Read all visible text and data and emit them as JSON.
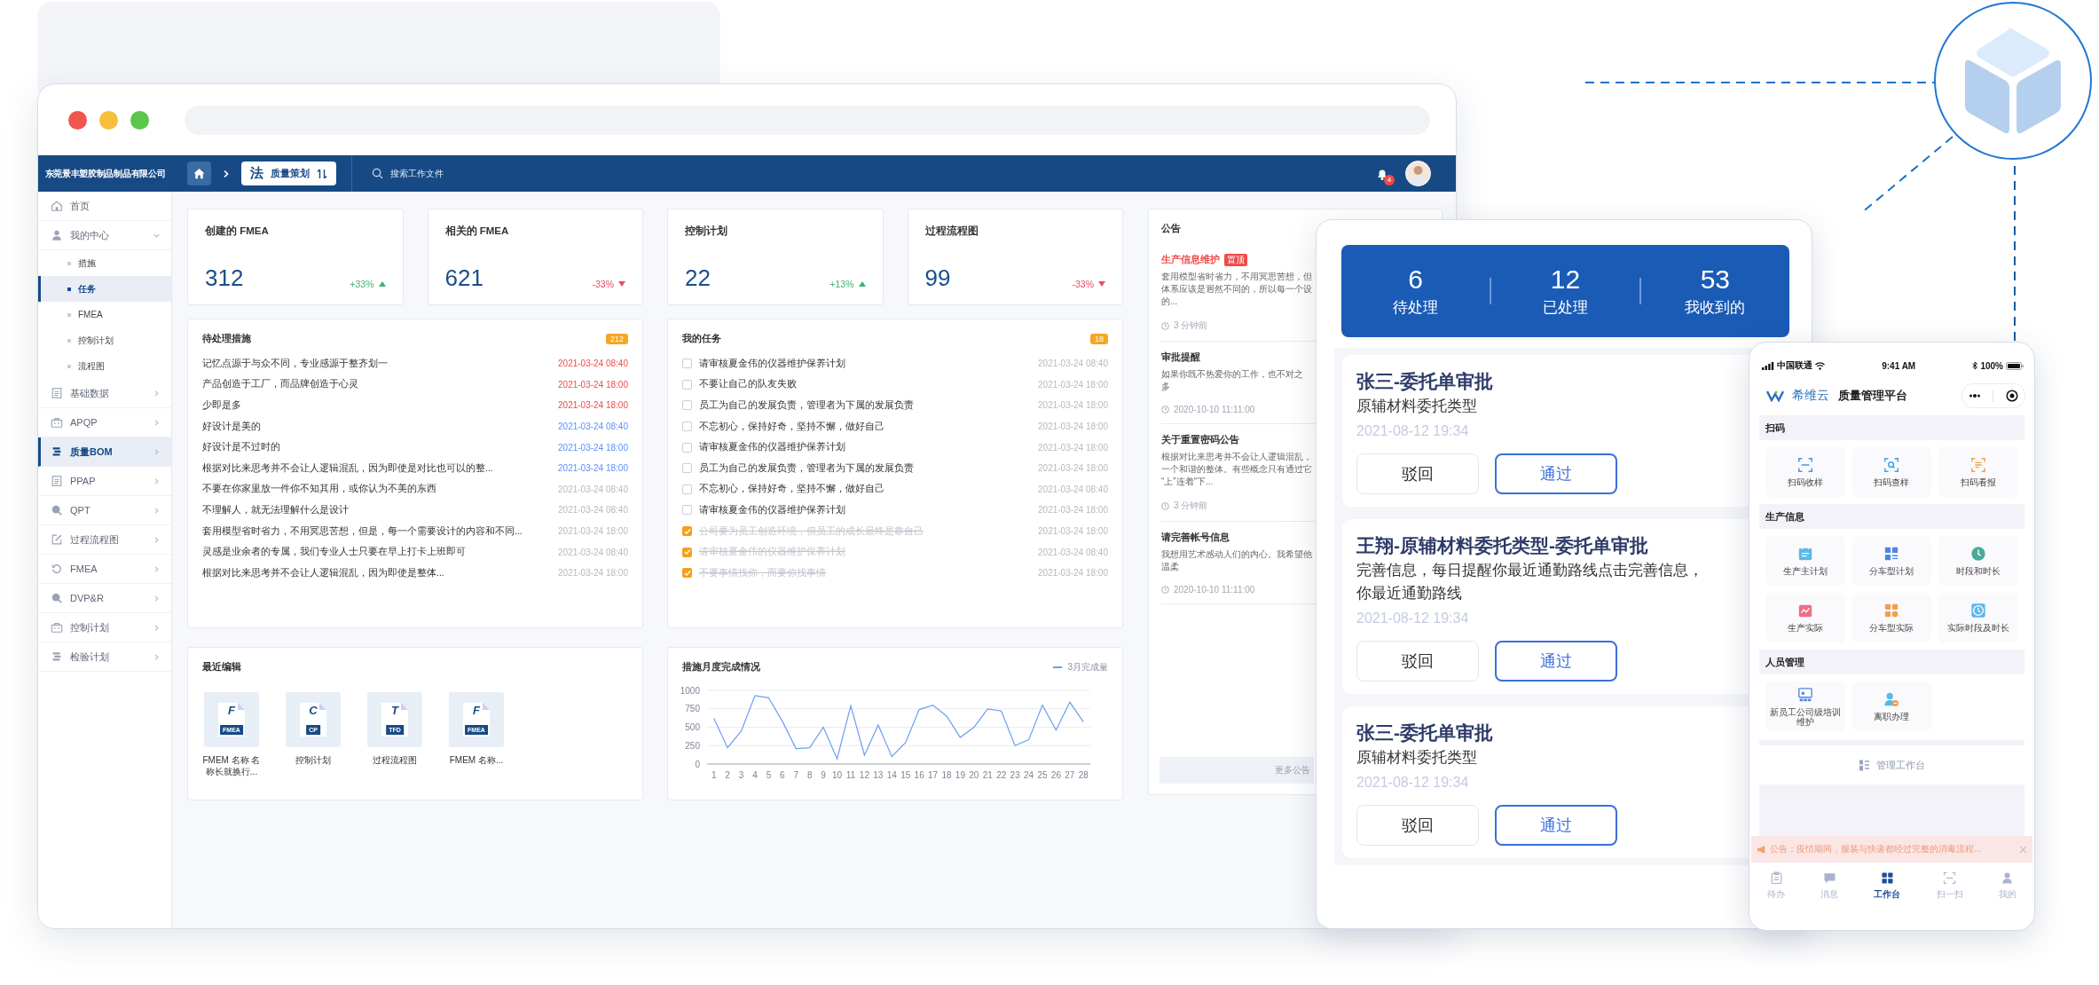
{
  "browser": {
    "company": "东莞景丰塑胶制品制品有限公司",
    "module_mark": "法",
    "module": "质量策划",
    "search": {
      "placeholder": "搜索工作文件"
    },
    "notifications": "4"
  },
  "sidebar": {
    "items": [
      {
        "label": "首页",
        "kind": "link",
        "selected": false
      },
      {
        "label": "我的中心",
        "kind": "group",
        "expanded": true,
        "selected": false,
        "children": [
          {
            "label": "措施",
            "selected": false
          },
          {
            "label": "任务",
            "selected": true
          },
          {
            "label": "FMEA",
            "selected": false
          },
          {
            "label": "控制计划",
            "selected": false
          },
          {
            "label": "流程图",
            "selected": false
          }
        ]
      },
      {
        "label": "基础数据",
        "kind": "group",
        "expanded": false,
        "selected": false
      },
      {
        "label": "APQP",
        "kind": "group",
        "expanded": false,
        "selected": false
      },
      {
        "label": "质量BOM",
        "kind": "group",
        "expanded": false,
        "selected": true
      },
      {
        "label": "PPAP",
        "kind": "group",
        "expanded": false,
        "selected": false
      },
      {
        "label": "QPT",
        "kind": "group",
        "expanded": false,
        "selected": false
      },
      {
        "label": "过程流程图",
        "kind": "group",
        "expanded": false,
        "selected": false
      },
      {
        "label": "FMEA",
        "kind": "group",
        "expanded": false,
        "selected": false
      },
      {
        "label": "DVP&R",
        "kind": "group",
        "expanded": false,
        "selected": false
      },
      {
        "label": "控制计划",
        "kind": "group",
        "expanded": false,
        "selected": false
      },
      {
        "label": "检验计划",
        "kind": "group",
        "expanded": false,
        "selected": false
      }
    ]
  },
  "stats": [
    {
      "title": "创建的 FMEA",
      "value": "312",
      "change": "+33%",
      "rising": true
    },
    {
      "title": "相关的 FMEA",
      "value": "621",
      "change": "-33%",
      "rising": false
    },
    {
      "title": "控制计划",
      "value": "22",
      "change": "+13%",
      "rising": true
    },
    {
      "title": "过程流程图",
      "value": "99",
      "change": "-33%",
      "rising": false
    }
  ],
  "pending": {
    "title": "待处理措施",
    "count": "212",
    "rows": [
      {
        "text": "记忆点源于与众不同，专业感源于整齐划一",
        "time": "2021-03-24 08:40",
        "color": "#f04a4a"
      },
      {
        "text": "产品创造于工厂，而品牌创造于心灵",
        "time": "2021-03-24 18:00",
        "color": "#f04a4a"
      },
      {
        "text": "少即是多",
        "time": "2021-03-24 18:00",
        "color": "#f04a4a"
      },
      {
        "text": "好设计是美的",
        "time": "2021-03-24 08:40",
        "color": "#5b8ff9"
      },
      {
        "text": "好设计是不过时的",
        "time": "2021-03-24 18:00",
        "color": "#5b8ff9"
      },
      {
        "text": "根据对比来思考并不会让人逻辑混乱，因为即使是对比也可以的整...",
        "time": "2021-03-24 18:00",
        "color": "#5b8ff9"
      },
      {
        "text": "不要在你家里放一件你不知其用，或你认为不美的东西",
        "time": "2021-03-24 08:40",
        "color": "#b5b9c2"
      },
      {
        "text": "不理解人，就无法理解什么是设计",
        "time": "2021-03-24 08:40",
        "color": "#b5b9c2"
      },
      {
        "text": "套用模型省时省力，不用冥思苦想，但是，每一个需要设计的内容和不同...",
        "time": "2021-03-24 18:00",
        "color": "#b5b9c2"
      },
      {
        "text": "灵感是业余者的专属，我们专业人士只要在早上打卡上班即可",
        "time": "2021-03-24 08:40",
        "color": "#b5b9c2"
      },
      {
        "text": "根据对比来思考并不会让人逻辑混乱，因为即使是整体...",
        "time": "2021-03-24 18:00",
        "color": "#b5b9c2"
      }
    ]
  },
  "tasks": {
    "title": "我的任务",
    "count": "18",
    "rows": [
      {
        "text": "请审核夏金伟的仪器维护保养计划",
        "time": "2021-03-24 08:40",
        "checked": false
      },
      {
        "text": "不要让自己的队友失败",
        "time": "2021-03-24 18:00",
        "checked": false
      },
      {
        "text": "员工为自己的发展负责，管理者为下属的发展负责",
        "time": "2021-03-24 18:00",
        "checked": false
      },
      {
        "text": "不忘初心，保持好奇，坚持不懈，做好自己",
        "time": "2021-03-24 18:00",
        "checked": false
      },
      {
        "text": "请审核夏金伟的仪器维护保养计划",
        "time": "2021-03-24 18:00",
        "checked": false
      },
      {
        "text": "员工为自己的发展负责，管理者为下属的发展负责",
        "time": "2021-03-24 18:00",
        "checked": false
      },
      {
        "text": "不忘初心，保持好奇，坚持不懈，做好自己",
        "time": "2021-03-24 08:40",
        "checked": false
      },
      {
        "text": "请审核夏金伟的仪器维护保养计划",
        "time": "2021-03-24 18:00",
        "checked": false
      },
      {
        "text": "公司要为员工创造环境，但员工的成长最终是靠自己",
        "time": "2021-03-24 18:00",
        "checked": true
      },
      {
        "text": "请审核夏金伟的仪器维护保养计划",
        "time": "2021-03-24 08:40",
        "checked": true
      },
      {
        "text": "不要事情找你，而要你找事情",
        "time": "2021-03-24 18:00",
        "checked": true
      }
    ]
  },
  "recent": {
    "title": "最近编辑",
    "files": [
      {
        "letter": "F",
        "tag": "FMEA",
        "name": "FMEM 名称 名称长就换行..."
      },
      {
        "letter": "C",
        "tag": "CP",
        "name": "控制计划"
      },
      {
        "letter": "T",
        "tag": "TFD",
        "name": "过程流程图"
      },
      {
        "letter": "F",
        "tag": "FMEA",
        "name": "FMEM 名称..."
      }
    ]
  },
  "progress_chart": {
    "chart_data": {
      "type": "line",
      "title": "措施月度完成情况",
      "x": [
        1,
        2,
        3,
        4,
        5,
        6,
        7,
        8,
        9,
        10,
        11,
        12,
        13,
        14,
        15,
        16,
        17,
        18,
        19,
        20,
        21,
        22,
        23,
        24,
        25,
        26,
        27,
        28
      ],
      "xlim": [
        0.5,
        28.5
      ],
      "grid": true,
      "ylim": [
        0,
        1000
      ],
      "yticks": [
        0,
        250,
        500,
        750,
        1000
      ],
      "xticks": [
        1,
        2,
        3,
        4,
        5,
        6,
        7,
        8,
        9,
        10,
        11,
        12,
        13,
        14,
        15,
        16,
        17,
        18,
        19,
        20,
        21,
        22,
        23,
        24,
        25,
        26,
        27,
        28
      ],
      "series": [
        {
          "name": "3月完成量",
          "color": "#6b9cf5",
          "values": [
            620,
            220,
            450,
            930,
            900,
            580,
            210,
            220,
            500,
            70,
            790,
            120,
            530,
            100,
            290,
            740,
            800,
            650,
            360,
            500,
            750,
            720,
            250,
            330,
            800,
            460,
            840,
            570
          ]
        }
      ]
    }
  },
  "announcements": {
    "title": "公告",
    "items": [
      {
        "title": "生产信息维护",
        "pinned": true,
        "tag": "置顶",
        "lines": [
          "套用模型省时省力，不用冥思苦想，但",
          "体系应该是迥然不同的，所以每一个设",
          "的..."
        ],
        "time": "3 分钟前"
      },
      {
        "title": "审批提醒",
        "pinned": false,
        "lines": [
          "如果你既不热爱你的工作，也不对之",
          "多"
        ],
        "time": "2020-10-10 11:11:00"
      },
      {
        "title": "关于重置密码公告",
        "pinned": false,
        "lines": [
          "根据对比来思考并不会让人逻辑混乱，",
          "一个和谐的整体。有些概念只有通过它",
          "“上”连着“下..."
        ],
        "time": "3 分钟前"
      },
      {
        "title": "请完善帐号信息",
        "pinned": false,
        "lines": [
          "我想用艺术感动人们的内心。我希望他",
          "温柔"
        ],
        "time": "2020-10-10 11:11:00"
      }
    ],
    "more": "更多公告"
  },
  "tablet": {
    "stats": [
      {
        "value": "6",
        "label": "待处理"
      },
      {
        "value": "12",
        "label": "已处理"
      },
      {
        "value": "53",
        "label": "我收到的"
      }
    ],
    "cards": [
      {
        "title": "张三-委托单审批",
        "lines": [
          "原辅材料委托类型"
        ],
        "time": "2021-08-12 19:34",
        "buttons": [
          {
            "label": "驳回",
            "kind": "secondary"
          },
          {
            "label": "通过",
            "kind": "primary"
          }
        ]
      },
      {
        "title": "王翔-原辅材料委托类型-委托单审批",
        "lines": [
          "完善信息，每日提醒你最近通勤路线点击完善信息，",
          "你最近通勤路线"
        ],
        "time": "2021-08-12 19:34",
        "buttons": [
          {
            "label": "驳回",
            "kind": "secondary"
          },
          {
            "label": "通过",
            "kind": "primary"
          }
        ]
      },
      {
        "title": "张三-委托单审批",
        "lines": [
          "原辅材料委托类型"
        ],
        "time": "2021-08-12 19:34",
        "buttons": [
          {
            "label": "驳回",
            "kind": "secondary"
          },
          {
            "label": "通过",
            "kind": "primary"
          }
        ]
      }
    ]
  },
  "phone": {
    "carrier": "中国联通",
    "clock": "9:41 AM",
    "battery": "100%",
    "brand": "希维云",
    "app_title": "质量管理平台",
    "sections": [
      {
        "title": "扫码",
        "items": [
          {
            "label": "扫码收样",
            "color": "#4a90e2"
          },
          {
            "label": "扫码查样",
            "color": "#3ba3e0"
          },
          {
            "label": "扫码看报",
            "color": "#f0a050"
          }
        ]
      },
      {
        "title": "生产信息",
        "items": [
          {
            "label": "生产主计划",
            "color": "#5bb8ea"
          },
          {
            "label": "分车型计划",
            "color": "#4f86e0"
          },
          {
            "label": "时段和时长",
            "color": "#4aaa9a"
          },
          {
            "label": "生产实际",
            "color": "#ec6f86"
          },
          {
            "label": "分车型实际",
            "color": "#f0a050"
          },
          {
            "label": "实际时段及时长",
            "color": "#5bb8ea"
          }
        ]
      },
      {
        "title": "人员管理",
        "items": [
          {
            "label": "新员工公司级培训维护",
            "color": "#4f86e0"
          },
          {
            "label": "离职办理",
            "color": "#5bb8ea"
          }
        ]
      }
    ],
    "workbench": "管理工作台",
    "notice": "公告：疫情期间，服装与快递都经过完整的消毒流程...",
    "tabs": [
      {
        "label": "待办",
        "selected": false
      },
      {
        "label": "消息",
        "selected": false
      },
      {
        "label": "工作台",
        "selected": true
      },
      {
        "label": "扫一扫",
        "selected": false
      },
      {
        "label": "我的",
        "selected": false
      }
    ]
  }
}
